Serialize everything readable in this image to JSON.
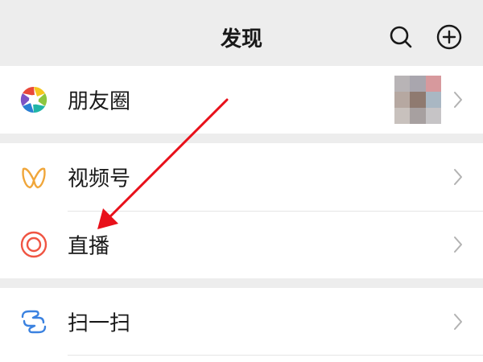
{
  "header": {
    "title": "发现",
    "search_icon": "search-icon",
    "add_icon": "plus-circle-icon"
  },
  "menu": {
    "moments": {
      "label": "朋友圈",
      "icon": "moments-aperture-icon"
    },
    "channels": {
      "label": "视频号",
      "icon": "channels-butterfly-icon"
    },
    "live": {
      "label": "直播",
      "icon": "live-rings-icon"
    },
    "scan": {
      "label": "扫一扫",
      "icon": "scan-icon"
    }
  },
  "colors": {
    "background": "#ededed",
    "cell": "#ffffff",
    "text": "#191919",
    "chevron": "#b2b2b2",
    "live_icon": "#f05543",
    "channels_icon": "#f0a63a",
    "scan_icon": "#3b82e0",
    "annotation_arrow": "#e8101a"
  },
  "moments_thumbnail_colors": [
    "#b8b4b6",
    "#a9a6ae",
    "#d7999d",
    "#b6a8a1",
    "#8f7a70",
    "#a9b7c3",
    "#c8c1bd",
    "#a7a0a0",
    "#c6c4c6"
  ]
}
